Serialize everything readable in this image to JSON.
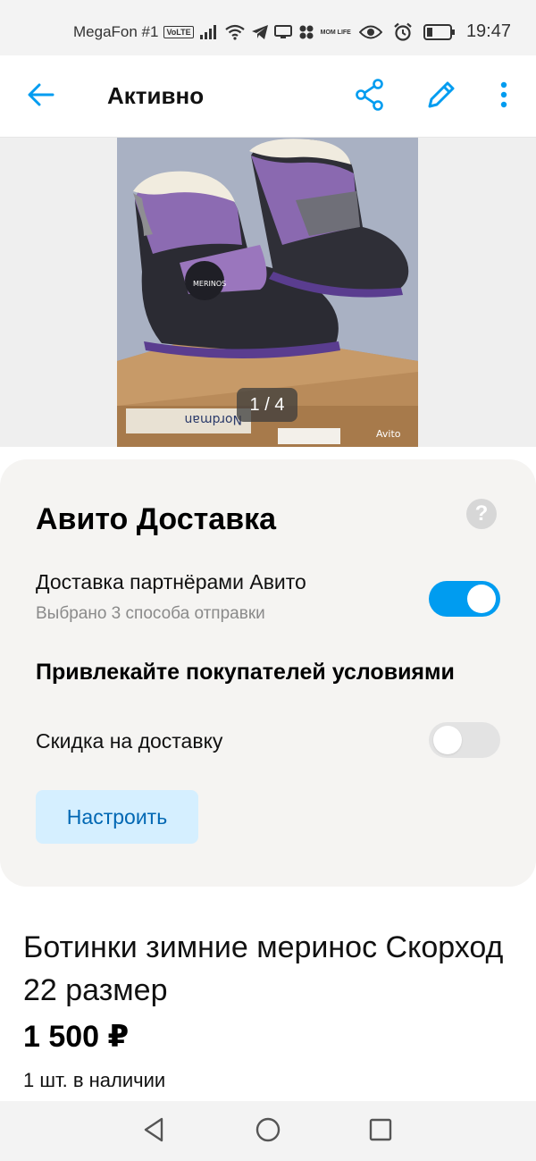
{
  "status_bar": {
    "carrier": "MegaFon #1",
    "volte": "VoLTE",
    "momlife": "MOM LIFE",
    "time": "19:47"
  },
  "app_bar": {
    "title": "Активно"
  },
  "gallery": {
    "counter": "1 / 4",
    "brand_text": "MERINOS",
    "box_text": "Nordman",
    "watermark": "Avito"
  },
  "delivery": {
    "title": "Авито Доставка",
    "help": "?",
    "partners_label": "Доставка партнёрами Авито",
    "partners_sub": "Выбрано 3 способа отправки",
    "partners_enabled": true,
    "attract_heading": "Привлекайте покупателей условиями",
    "discount_label": "Скидка на доставку",
    "discount_enabled": false,
    "configure_button": "Настроить"
  },
  "listing": {
    "title": "Ботинки зимние меринос Скорход 22 размер",
    "price": "1 500 ₽",
    "stock": "1 шт. в наличии"
  },
  "colors": {
    "accent": "#009cf0",
    "button_bg": "#d5efff",
    "button_text": "#0067b3",
    "card_bg": "#f5f4f2"
  }
}
